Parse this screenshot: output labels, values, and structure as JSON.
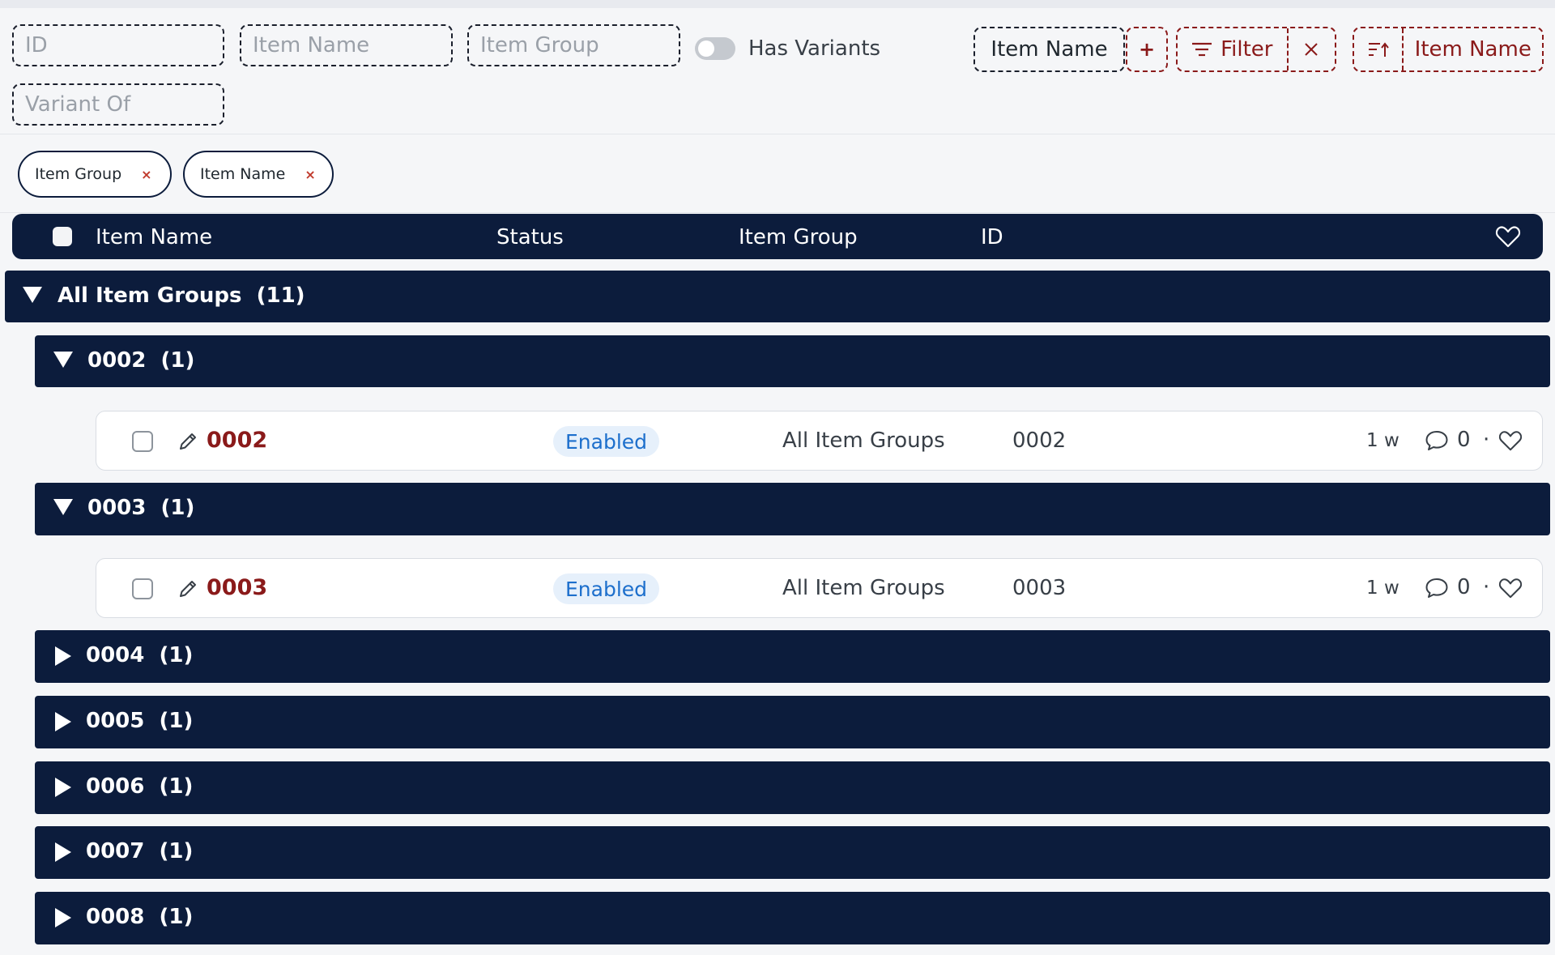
{
  "filters": {
    "id_placeholder": "ID",
    "item_name_placeholder": "Item Name",
    "item_group_placeholder": "Item Group",
    "variant_of_placeholder": "Variant Of",
    "has_variants_label": "Has Variants",
    "has_variants_on": false
  },
  "toolbar": {
    "group_by_label": "Item Name",
    "add_label": "+",
    "filter_label": "Filter",
    "clear_label": "×",
    "sort_label": "Item Name",
    "icons": [
      "filter-lines-icon",
      "close-icon",
      "sort-ascending-icon"
    ]
  },
  "chips": [
    {
      "label": "Item Group",
      "remove": "×"
    },
    {
      "label": "Item Name",
      "remove": "×"
    }
  ],
  "table": {
    "columns": [
      "Item Name",
      "Status",
      "Item Group",
      "ID"
    ],
    "header_icon": "heart-icon"
  },
  "groups": {
    "root": {
      "label": "All Item Groups  (11)",
      "expanded": true
    },
    "items": [
      {
        "label": "0002  (1)",
        "expanded": true
      },
      {
        "label": "0003  (1)",
        "expanded": true
      },
      {
        "label": "0004  (1)",
        "expanded": false
      },
      {
        "label": "0005  (1)",
        "expanded": false
      },
      {
        "label": "0006  (1)",
        "expanded": false
      },
      {
        "label": "0007  (1)",
        "expanded": false
      },
      {
        "label": "0008  (1)",
        "expanded": false
      }
    ]
  },
  "rows": [
    {
      "name": "0002",
      "status": "Enabled",
      "item_group": "All Item Groups",
      "id": "0002",
      "age": "1 w",
      "comments": "0",
      "separator": "·"
    },
    {
      "name": "0003",
      "status": "Enabled",
      "item_group": "All Item Groups",
      "id": "0003",
      "age": "1 w",
      "comments": "0",
      "separator": "·"
    }
  ],
  "colors": {
    "navy": "#0c1c3c",
    "brand_red": "#8a1a1a",
    "enabled_blue": "#1d6fcc"
  }
}
